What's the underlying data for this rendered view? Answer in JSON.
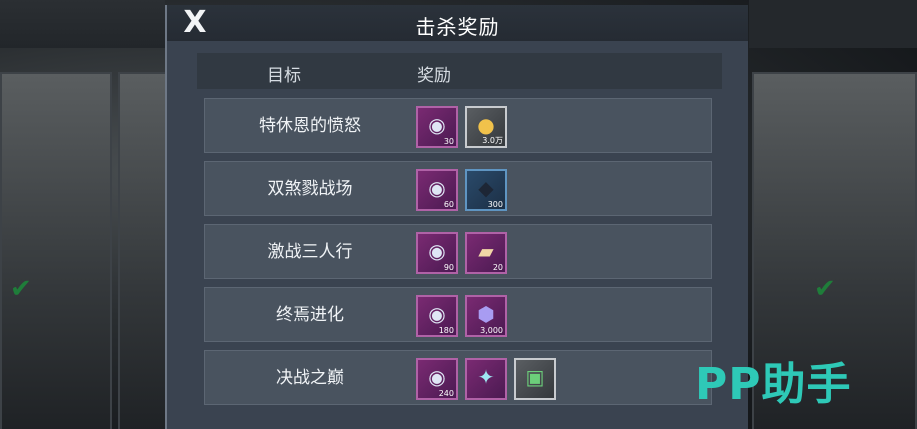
{
  "dialog": {
    "title": "击杀奖励",
    "close_symbol": "X",
    "columns": {
      "target": "目标",
      "reward": "奖励"
    },
    "rows": [
      {
        "label": "特休恩的愤怒",
        "rewards": [
          {
            "icon": "silver-coin-icon",
            "qty": "30",
            "rarity": "purple"
          },
          {
            "icon": "gold-coin-icon",
            "qty": "3.0万",
            "rarity": "grey"
          }
        ]
      },
      {
        "label": "双煞戮战场",
        "rewards": [
          {
            "icon": "silver-coin-icon",
            "qty": "60",
            "rarity": "purple"
          },
          {
            "icon": "supply-box-icon",
            "qty": "300",
            "rarity": "blue"
          }
        ]
      },
      {
        "label": "激战三人行",
        "rewards": [
          {
            "icon": "silver-coin-icon",
            "qty": "90",
            "rarity": "purple"
          },
          {
            "icon": "ticket-icon",
            "qty": "20",
            "rarity": "purple"
          }
        ]
      },
      {
        "label": "终焉进化",
        "rewards": [
          {
            "icon": "silver-coin-icon",
            "qty": "180",
            "rarity": "purple"
          },
          {
            "icon": "purple-gem-icon",
            "qty": "3,000",
            "rarity": "purple"
          }
        ]
      },
      {
        "label": "决战之巅",
        "rewards": [
          {
            "icon": "silver-coin-icon",
            "qty": "240",
            "rarity": "purple"
          },
          {
            "icon": "crystal-icon",
            "qty": "",
            "rarity": "purple"
          },
          {
            "icon": "bucket-icon",
            "qty": "",
            "rarity": "grey"
          }
        ]
      }
    ]
  },
  "watermark": "PP助手"
}
